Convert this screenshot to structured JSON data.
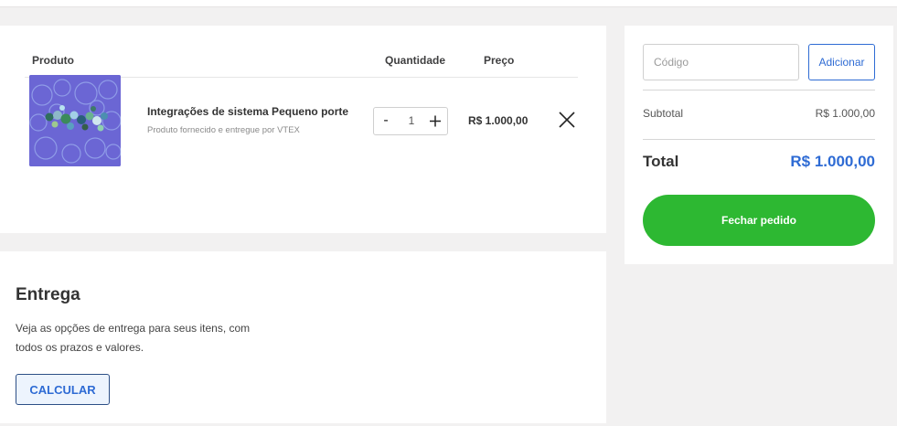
{
  "cart": {
    "headers": {
      "product": "Produto",
      "quantity": "Quantidade",
      "price": "Preço"
    },
    "item": {
      "name": "Integrações de sistema Pequeno porte",
      "seller": "Produto fornecido e entregue por VTEX",
      "quantity": "1",
      "minus": "-",
      "price": "R$ 1.000,00",
      "image_icon": "product-image",
      "remove_icon": "close-icon"
    }
  },
  "delivery": {
    "title": "Entrega",
    "description": "Veja as opções de entrega para seus itens, com todos os prazos e valores.",
    "button": "CALCULAR"
  },
  "summary": {
    "coupon_placeholder": "Código",
    "coupon_button": "Adicionar",
    "subtotal_label": "Subtotal",
    "subtotal_value": "R$ 1.000,00",
    "total_label": "Total",
    "total_value": "R$ 1.000,00",
    "checkout_button": "Fechar pedido"
  },
  "colors": {
    "accent_blue": "#2e6bd4",
    "checkout_green": "#2db832",
    "background": "#f2f1f1"
  }
}
